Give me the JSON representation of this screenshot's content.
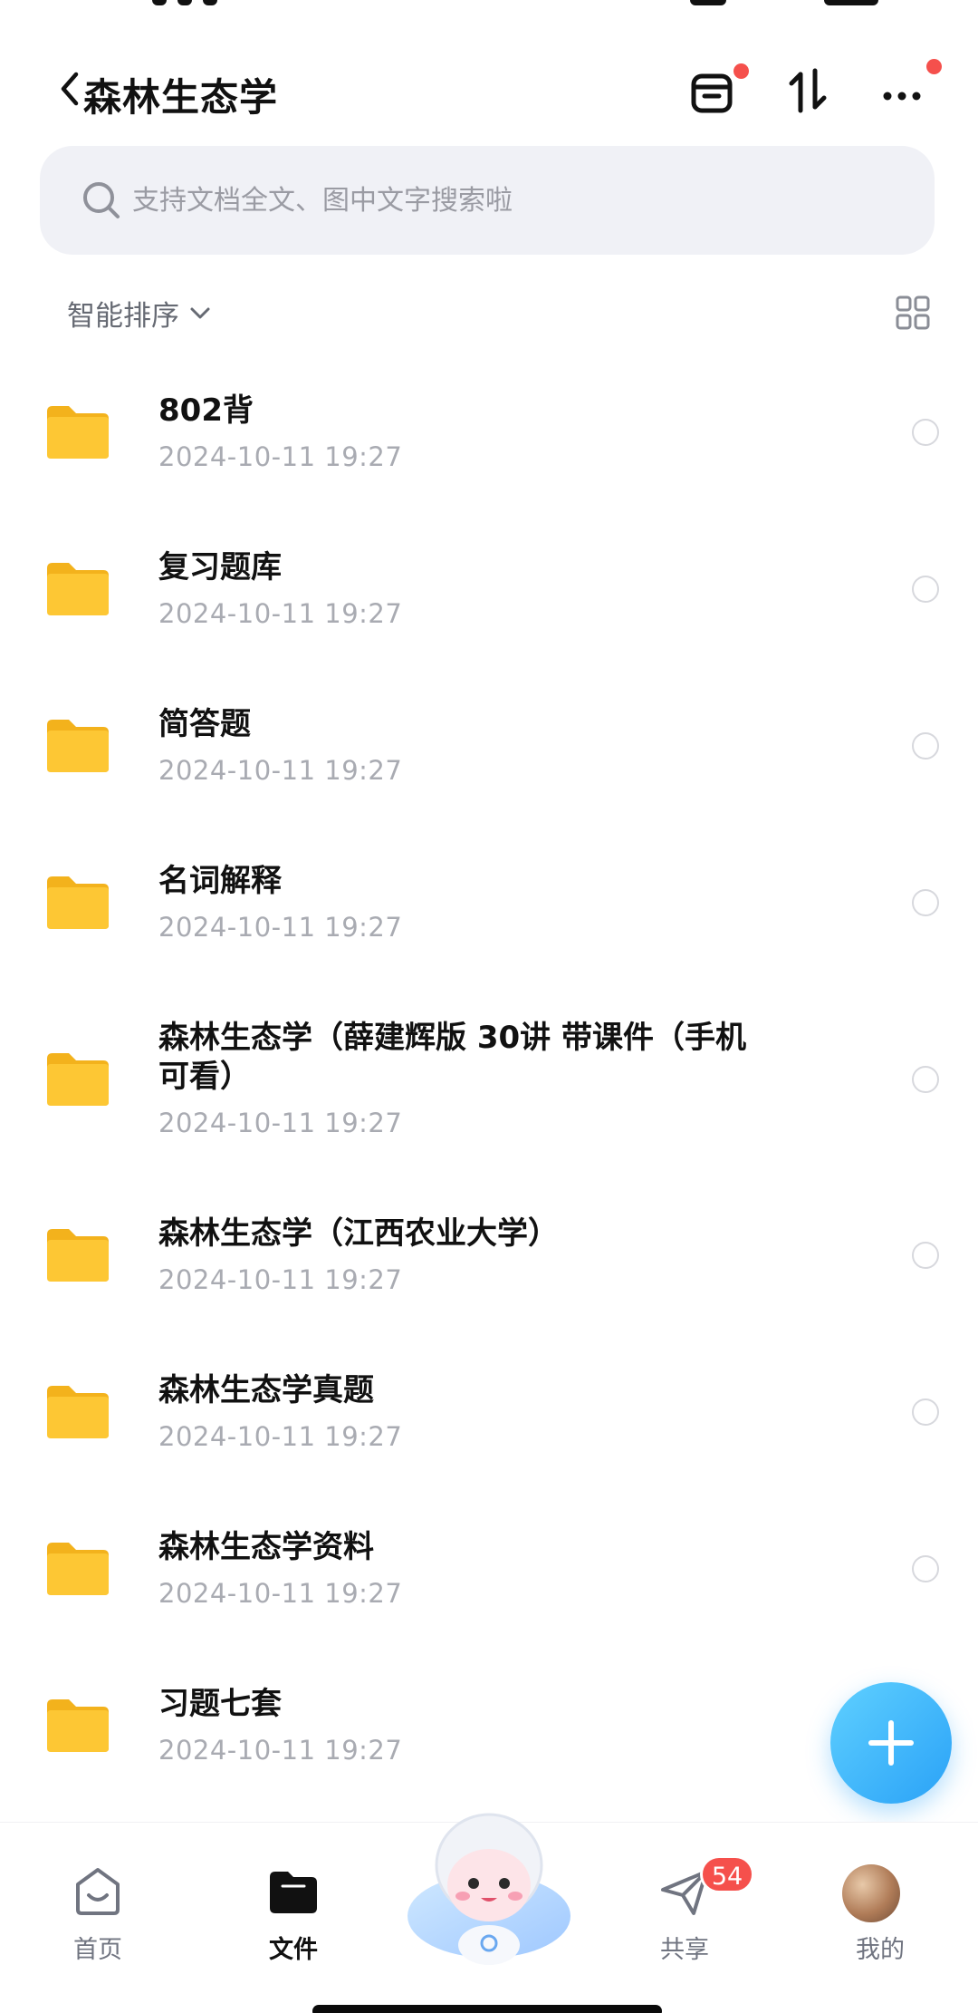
{
  "header": {
    "title": "森林生态学",
    "back_icon": "chevron-left-icon",
    "actions": [
      {
        "name": "clip-box-icon",
        "notification": true
      },
      {
        "name": "sort-arrows-icon",
        "notification": false
      },
      {
        "name": "more-icon",
        "notification": true
      }
    ]
  },
  "search": {
    "placeholder": "支持文档全文、图中文字搜索啦",
    "value": ""
  },
  "sort": {
    "label": "智能排序",
    "view_toggle_icon": "grid-view-icon"
  },
  "files": [
    {
      "name": "802背",
      "date": "2024-10-11 19:27"
    },
    {
      "name": "复习题库",
      "date": "2024-10-11 19:27"
    },
    {
      "name": "简答题",
      "date": "2024-10-11 19:27"
    },
    {
      "name": "名词解释",
      "date": "2024-10-11 19:27"
    },
    {
      "name": "森林生态学（薛建辉版 30讲 带课件（手机可看）",
      "date": "2024-10-11 19:27"
    },
    {
      "name": "森林生态学（江西农业大学）",
      "date": "2024-10-11 19:27"
    },
    {
      "name": "森林生态学真题",
      "date": "2024-10-11 19:27"
    },
    {
      "name": "森林生态学资料",
      "date": "2024-10-11 19:27"
    },
    {
      "name": "习题七套",
      "date": "2024-10-11 19:27"
    }
  ],
  "fab": {
    "icon": "plus-icon"
  },
  "nav": {
    "tabs": [
      {
        "label": "首页",
        "icon": "home-icon",
        "active": false
      },
      {
        "label": "文件",
        "icon": "folder-icon",
        "active": true
      },
      {
        "label": "",
        "icon": "mascot-icon",
        "active": false
      },
      {
        "label": "共享",
        "icon": "share-send-icon",
        "active": false,
        "badge": "54"
      },
      {
        "label": "我的",
        "icon": "avatar",
        "active": false
      }
    ]
  },
  "colors": {
    "accent": "#2aa2f7",
    "folder": "#fdc734",
    "badge": "#f5504c",
    "search_bg": "#f0f1f6"
  }
}
